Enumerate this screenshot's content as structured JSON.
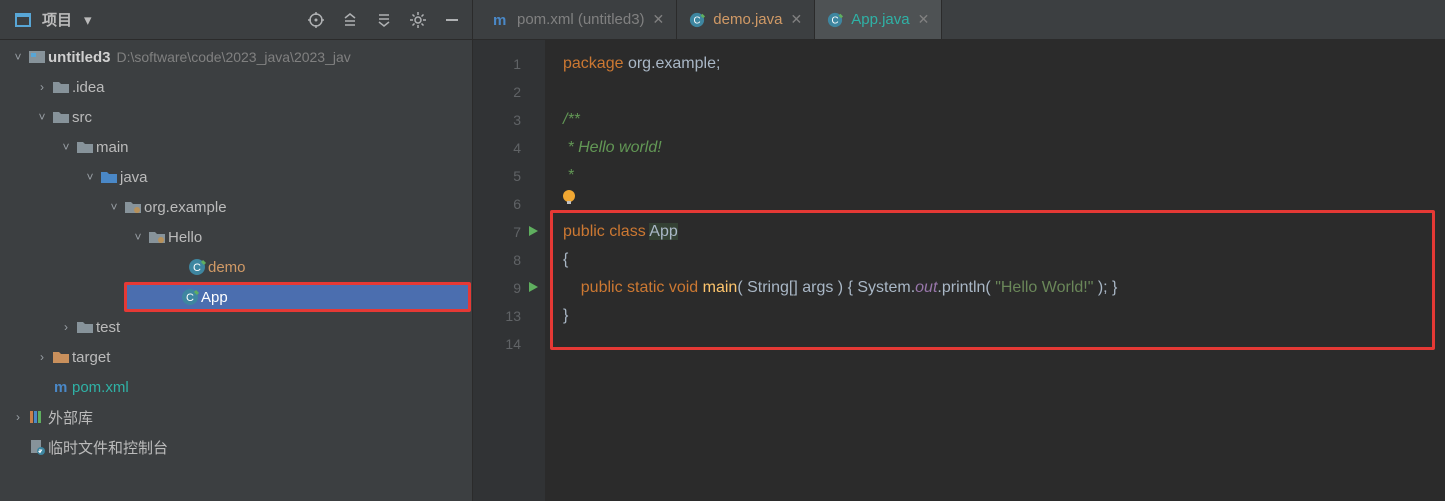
{
  "panel": {
    "title": "项目",
    "toolbar_icons": [
      "target-icon",
      "collapse-all-icon",
      "expand-all-icon",
      "settings-icon",
      "minimize-icon"
    ]
  },
  "tree": {
    "root": {
      "label": "untitled3",
      "path": "D:\\software\\code\\2023_java\\2023_jav"
    },
    "idea": ".idea",
    "src": "src",
    "main": "main",
    "java": "java",
    "pkg": "org.example",
    "hello": "Hello",
    "demo": "demo",
    "app": "App",
    "test": "test",
    "target": "target",
    "pom": "pom.xml",
    "ext_libs": "外部库",
    "scratch": "临时文件和控制台"
  },
  "tabs": [
    {
      "label": "pom.xml (untitled3)",
      "icon": "maven-icon",
      "active": false,
      "color": ""
    },
    {
      "label": "demo.java",
      "icon": "class-icon",
      "active": false,
      "color": "orange"
    },
    {
      "label": "App.java",
      "icon": "class-icon",
      "active": true,
      "color": "teal"
    }
  ],
  "gutter": {
    "lines": [
      "1",
      "2",
      "3",
      "4",
      "5",
      "6",
      "7",
      "8",
      "9",
      "13",
      "14"
    ],
    "run_markers": [
      7,
      9
    ]
  },
  "code": {
    "l1a": "package ",
    "l1b": "org.example",
    "l1c": ";",
    "l3": "/**",
    "l4": " * Hello world!",
    "l5": " *",
    "l7a": "public class ",
    "l7b": "App",
    "l8": "{",
    "l9a": "    public static void ",
    "l9b": "main",
    "l9c": "( String[] args ) { System.",
    "l9d": "out",
    "l9e": ".println( ",
    "l9f": "\"Hello World!\"",
    "l9g": " ); }",
    "l13": "}"
  }
}
